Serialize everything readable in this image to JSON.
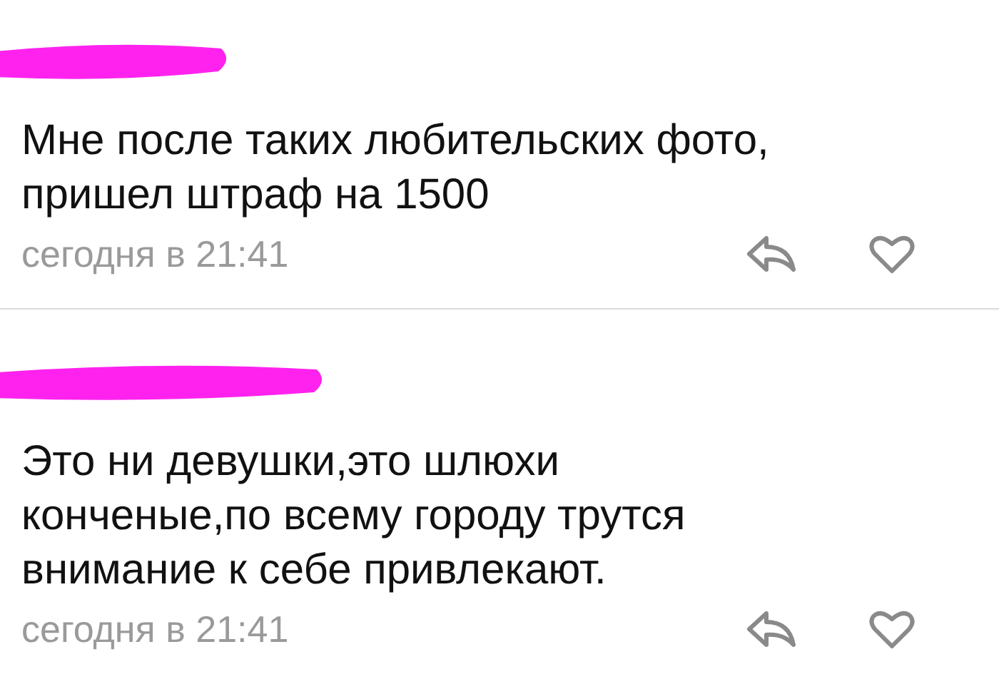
{
  "comments": [
    {
      "lines": [
        "Мне после таких любительских фото,",
        "пришел штраф на 1500"
      ],
      "time": "сегодня в 21:41",
      "liked": false
    },
    {
      "lines": [
        "Это ни девушки,это шлюхи",
        "конченые,по всему городу трутся",
        "внимание к себе привлекают."
      ],
      "time": "сегодня в 21:41",
      "liked": false
    }
  ]
}
